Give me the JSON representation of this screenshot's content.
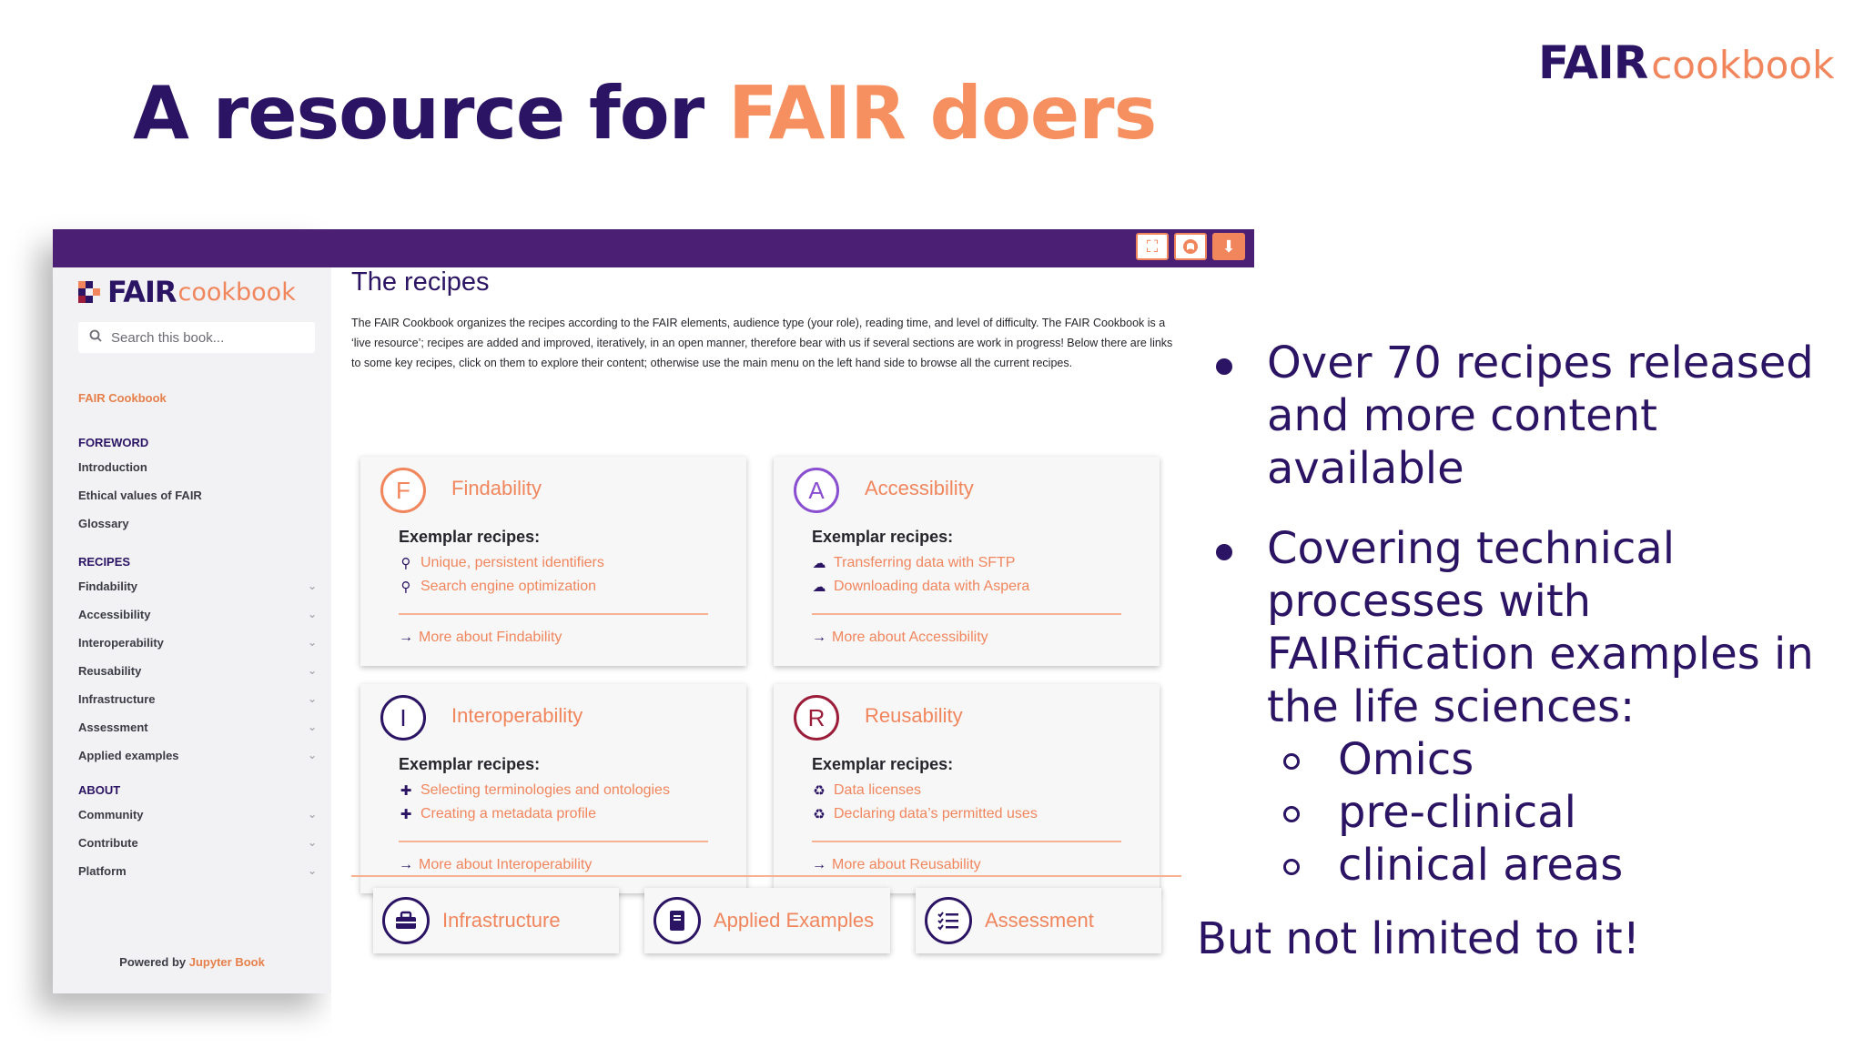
{
  "slide": {
    "title_part1": "A resource for",
    "title_accent": "FAIR doers",
    "logo_fair": "FAIR",
    "logo_cookbook": "cookbook",
    "bullets": [
      "Over 70 recipes released and more content available",
      "Covering technical processes with FAIRification examples in the life sciences:"
    ],
    "sub_bullets": [
      "Omics",
      "pre-clinical",
      "clinical areas"
    ],
    "tail": "But not limited to it!"
  },
  "toolbar": {
    "buttons": [
      "fullscreen-icon",
      "github-icon",
      "download-icon"
    ]
  },
  "sidebar": {
    "logo_fair": "FAIR",
    "logo_cookbook": "cookbook",
    "search_placeholder": "Search this book...",
    "home": "FAIR Cookbook",
    "sections": [
      {
        "heading": "FOREWORD",
        "items": [
          "Introduction",
          "Ethical values of FAIR",
          "Glossary"
        ]
      },
      {
        "heading": "RECIPES",
        "items": [
          "Findability",
          "Accessibility",
          "Interoperability",
          "Reusability",
          "Infrastructure",
          "Assessment",
          "Applied examples"
        ]
      },
      {
        "heading": "ABOUT",
        "items": [
          "Community",
          "Contribute",
          "Platform"
        ]
      }
    ],
    "powered_by": "Powered by",
    "powered_link": "Jupyter Book"
  },
  "main": {
    "title": "The recipes",
    "intro": "The FAIR Cookbook organizes the recipes according to the FAIR elements, audience type (your role), reading time, and level of difficulty. The FAIR Cookbook is a ‘live resource’; recipes are added and improved, iteratively, in an open manner, therefore bear with us if several sections are work in progress! Below there are links to some key recipes, click on them to explore their content; otherwise use the main menu on the left hand side to browse all the current recipes.",
    "exemplar_label": "Exemplar recipes:",
    "cards": [
      {
        "letter": "F",
        "title": "Findability",
        "color": "#f1865d",
        "links": [
          "Unique, persistent identifiers",
          "Search engine optimization"
        ],
        "link_icon": "search-icon",
        "more": "More about Findability"
      },
      {
        "letter": "A",
        "title": "Accessibility",
        "color": "#8a4fd1",
        "links": [
          "Transferring data with SFTP",
          "Downloading data with Aspera"
        ],
        "link_icon": "cloud-icon",
        "more": "More about Accessibility"
      },
      {
        "letter": "I",
        "title": "Interoperability",
        "color": "#2b1463",
        "links": [
          "Selecting terminologies and ontologies",
          "Creating a metadata profile"
        ],
        "link_icon": "puzzle-icon",
        "more": "More about Interoperability"
      },
      {
        "letter": "R",
        "title": "Reusability",
        "color": "#9c1d3a",
        "links": [
          "Data licenses",
          "Declaring data’s permitted uses"
        ],
        "link_icon": "recycle-icon",
        "more": "More about Reusability"
      }
    ],
    "bottom_cards": [
      {
        "label": "Infrastructure",
        "icon": "toolbox-icon"
      },
      {
        "label": "Applied Examples",
        "icon": "book-icon"
      },
      {
        "label": "Assessment",
        "icon": "checklist-icon"
      }
    ]
  }
}
